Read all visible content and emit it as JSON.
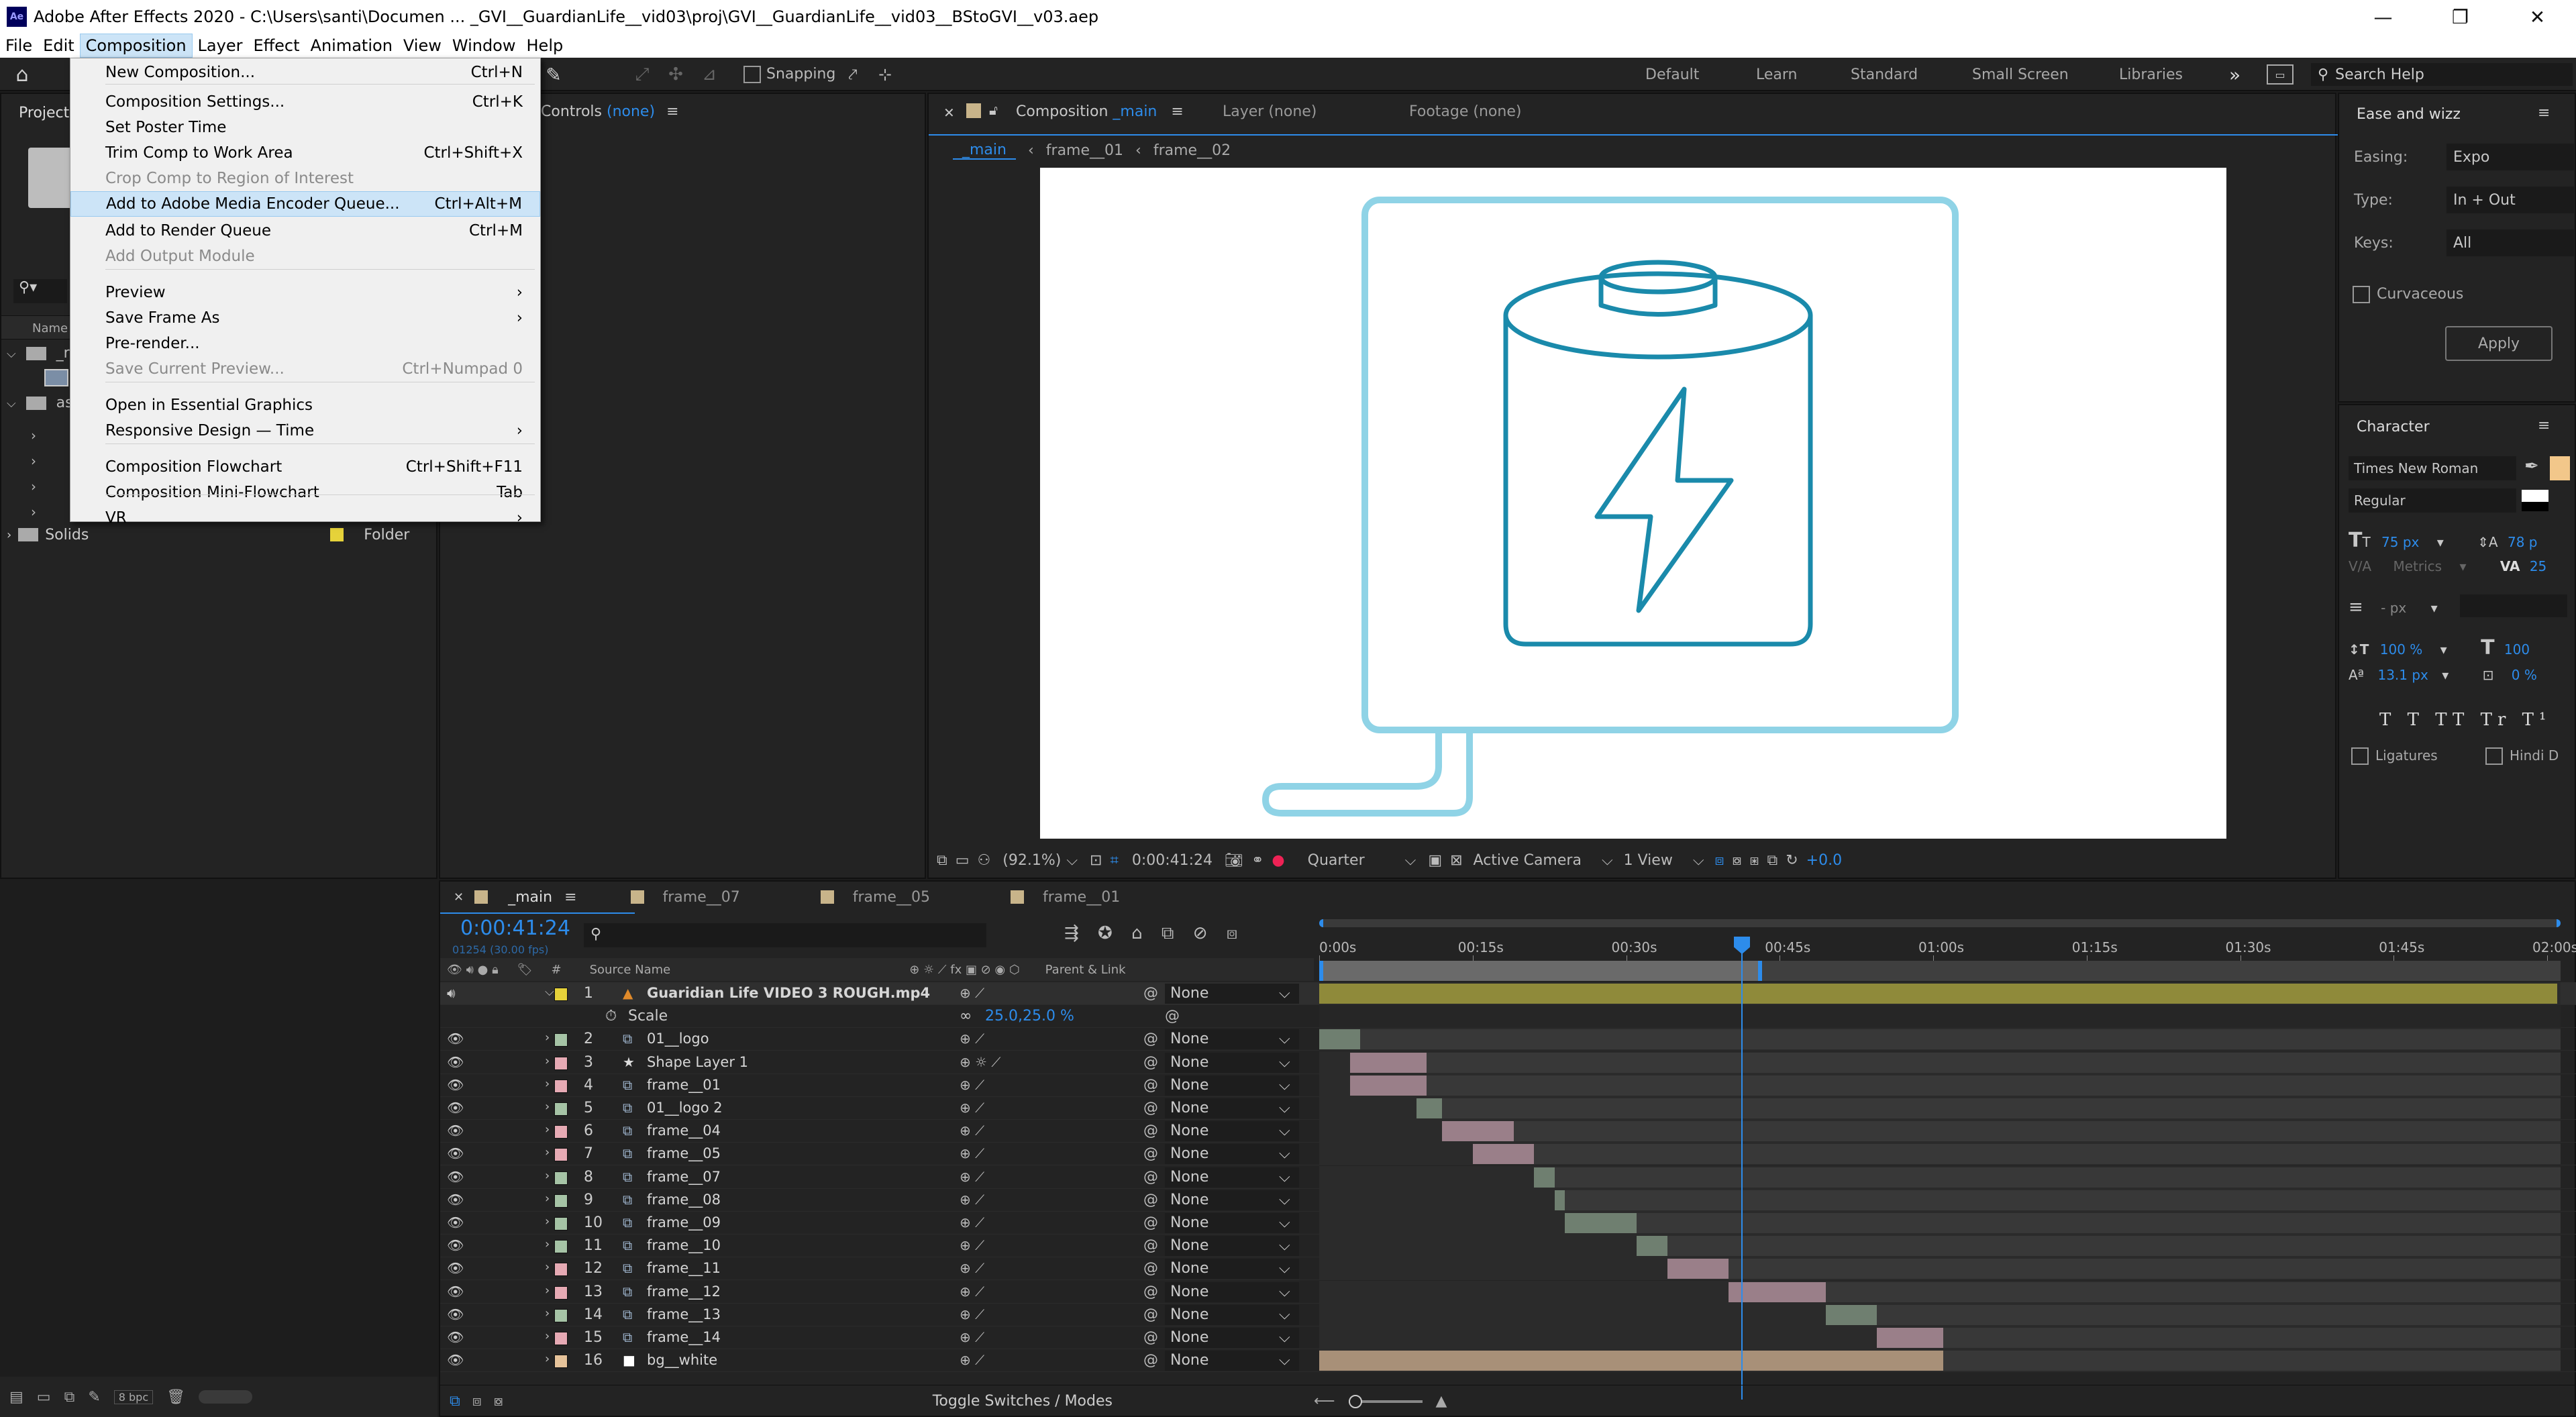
{
  "titlebar": {
    "title": "Adobe After Effects 2020 - C:\\Users\\santi\\Documen ... _GVI__GuardianLife__vid03\\proj\\GVI__GuardianLife__vid03__BStoGVI__v03.aep",
    "app_badge": "Ae"
  },
  "menubar": {
    "items": [
      "File",
      "Edit",
      "Composition",
      "Layer",
      "Effect",
      "Animation",
      "View",
      "Window",
      "Help"
    ]
  },
  "toolbar": {
    "snapping_label": "Snapping",
    "workspaces": [
      "Default",
      "Learn",
      "Standard",
      "Small Screen",
      "Libraries"
    ],
    "overflow": "»",
    "search_placeholder": "Search Help"
  },
  "composition_menu": {
    "items": [
      {
        "label": "New Composition...",
        "shortcut": "Ctrl+N",
        "disabled": false
      },
      {
        "label": "Composition Settings...",
        "shortcut": "Ctrl+K",
        "disabled": false
      },
      {
        "label": "Set Poster Time",
        "shortcut": "",
        "disabled": false
      },
      {
        "label": "Trim Comp to Work Area",
        "shortcut": "Ctrl+Shift+X",
        "disabled": false
      },
      {
        "label": "Crop Comp to Region of Interest",
        "shortcut": "",
        "disabled": true
      },
      {
        "label": "Add to Adobe Media Encoder Queue...",
        "shortcut": "Ctrl+Alt+M",
        "disabled": false,
        "highlighted": true
      },
      {
        "label": "Add to Render Queue",
        "shortcut": "Ctrl+M",
        "disabled": false
      },
      {
        "label": "Add Output Module",
        "shortcut": "",
        "disabled": true
      },
      {
        "label": "Preview",
        "shortcut": "›",
        "disabled": false
      },
      {
        "label": "Save Frame As",
        "shortcut": "›",
        "disabled": false
      },
      {
        "label": "Pre-render...",
        "shortcut": "",
        "disabled": false
      },
      {
        "label": "Save Current Preview...",
        "shortcut": "Ctrl+Numpad 0",
        "disabled": true
      },
      {
        "label": "Open in Essential Graphics",
        "shortcut": "",
        "disabled": false
      },
      {
        "label": "Responsive Design — Time",
        "shortcut": "›",
        "disabled": false
      },
      {
        "label": "Composition Flowchart",
        "shortcut": "Ctrl+Shift+F11",
        "disabled": false
      },
      {
        "label": "Composition Mini-Flowchart",
        "shortcut": "Tab",
        "disabled": false
      },
      {
        "label": "VR",
        "shortcut": "›",
        "disabled": false
      }
    ]
  },
  "project_panel": {
    "title": "Project",
    "column_name": "Name",
    "truncated_items": [
      "_re",
      "ass"
    ],
    "solids_label": "Solids",
    "solids_type": "Folder",
    "bpc": "8 bpc"
  },
  "effect_controls": {
    "title": "Controls",
    "value": "(none)"
  },
  "viewer": {
    "tab_comp": "Composition",
    "tab_comp_name": "_main",
    "tab_layer": "Layer",
    "tab_layer_value": "(none)",
    "tab_footage": "Footage",
    "tab_footage_value": "(none)",
    "breadcrumbs": [
      "_main",
      "frame__01",
      "frame__02"
    ],
    "zoom": "(92.1%)",
    "timecode": "0:00:41:24",
    "resolution": "Quarter",
    "camera": "Active Camera",
    "views": "1 View",
    "exposure": "+0.0",
    "icon_color": "#1a8aab",
    "frame_color": "#8fd3e6"
  },
  "ease_panel": {
    "title": "Ease and wizz",
    "easing_label": "Easing:",
    "easing_value": "Expo",
    "type_label": "Type:",
    "type_value": "In + Out",
    "keys_label": "Keys:",
    "keys_value": "All",
    "curvaceous": "Curvaceous",
    "apply": "Apply"
  },
  "character_panel": {
    "title": "Character",
    "font": "Times New Roman",
    "style": "Regular",
    "size": "75 px",
    "leading": "78 p",
    "kerning": "Metrics",
    "tracking": "25",
    "stroke": "- px",
    "vscale": "100 %",
    "hscale": "100",
    "baseline": "13.1 px",
    "tsume": "0 %",
    "ligatures": "Ligatures",
    "hindi": "Hindi D"
  },
  "timeline": {
    "tabs": [
      "_main",
      "frame__07",
      "frame__05",
      "frame__01"
    ],
    "timecode": "0:00:41:24",
    "fps_info": "01254 (30.00 fps)",
    "col_source": "Source Name",
    "col_parent": "Parent & Link",
    "ruler": [
      "0:00s",
      "00:15s",
      "00:30s",
      "00:45s",
      "01:00s",
      "01:15s",
      "01:30s",
      "01:45s",
      "02:00s"
    ],
    "scale_label": "Scale",
    "scale_value": "25.0,25.0 %",
    "toggle": "Toggle Switches / Modes",
    "layers": [
      {
        "num": "1",
        "name": "Guaridian Life  VIDEO 3 ROUGH.mp4",
        "parent": "None",
        "label_color": "#e6d23a",
        "type": "video",
        "start": 0,
        "end": 121,
        "bar_color": "#8f8a3a"
      },
      {
        "num": "2",
        "name": "01__logo",
        "parent": "None",
        "label_color": "#a6c4a6",
        "type": "comp",
        "start": 0,
        "end": 4,
        "bar_color": "#6f7f70"
      },
      {
        "num": "3",
        "name": "Shape Layer 1",
        "parent": "None",
        "label_color": "#e6aab4",
        "type": "shape",
        "start": 3,
        "end": 10.5,
        "bar_color": "#9a7f89"
      },
      {
        "num": "4",
        "name": "frame__01",
        "parent": "None",
        "label_color": "#e6aab4",
        "type": "comp",
        "start": 3,
        "end": 10.5,
        "bar_color": "#9a7f89"
      },
      {
        "num": "5",
        "name": "01__logo 2",
        "parent": "None",
        "label_color": "#a6c4a6",
        "type": "comp",
        "start": 9.5,
        "end": 12,
        "bar_color": "#6f7f70"
      },
      {
        "num": "6",
        "name": "frame__04",
        "parent": "None",
        "label_color": "#e6aab4",
        "type": "comp",
        "start": 12,
        "end": 19,
        "bar_color": "#9a7f89"
      },
      {
        "num": "7",
        "name": "frame__05",
        "parent": "None",
        "label_color": "#e6aab4",
        "type": "comp",
        "start": 15,
        "end": 21,
        "bar_color": "#9a7f89"
      },
      {
        "num": "8",
        "name": "frame__07",
        "parent": "None",
        "label_color": "#a6c4a6",
        "type": "comp",
        "start": 21,
        "end": 23,
        "bar_color": "#6f7f70"
      },
      {
        "num": "9",
        "name": "frame__08",
        "parent": "None",
        "label_color": "#a6c4a6",
        "type": "comp",
        "start": 23,
        "end": 24,
        "bar_color": "#6f7f70"
      },
      {
        "num": "10",
        "name": "frame__09",
        "parent": "None",
        "label_color": "#a6c4a6",
        "type": "comp",
        "start": 24,
        "end": 31,
        "bar_color": "#6f7f70"
      },
      {
        "num": "11",
        "name": "frame__10",
        "parent": "None",
        "label_color": "#a6c4a6",
        "type": "comp",
        "start": 31,
        "end": 34,
        "bar_color": "#6f7f70"
      },
      {
        "num": "12",
        "name": "frame__11",
        "parent": "None",
        "label_color": "#e6aab4",
        "type": "comp",
        "start": 34,
        "end": 40,
        "bar_color": "#9a7f89"
      },
      {
        "num": "13",
        "name": "frame__12",
        "parent": "None",
        "label_color": "#e6aab4",
        "type": "comp",
        "start": 40,
        "end": 49.5,
        "bar_color": "#9a7f89"
      },
      {
        "num": "14",
        "name": "frame__13",
        "parent": "None",
        "label_color": "#a6c4a6",
        "type": "comp",
        "start": 49.5,
        "end": 54.5,
        "bar_color": "#6f7f70"
      },
      {
        "num": "15",
        "name": "frame__14",
        "parent": "None",
        "label_color": "#e6aab4",
        "type": "comp",
        "start": 54.5,
        "end": 61,
        "bar_color": "#9a7f89"
      },
      {
        "num": "16",
        "name": "bg__white",
        "parent": "None",
        "label_color": "#e6c39a",
        "type": "solid",
        "start": 0,
        "end": 61,
        "bar_color": "#a89078"
      }
    ]
  }
}
